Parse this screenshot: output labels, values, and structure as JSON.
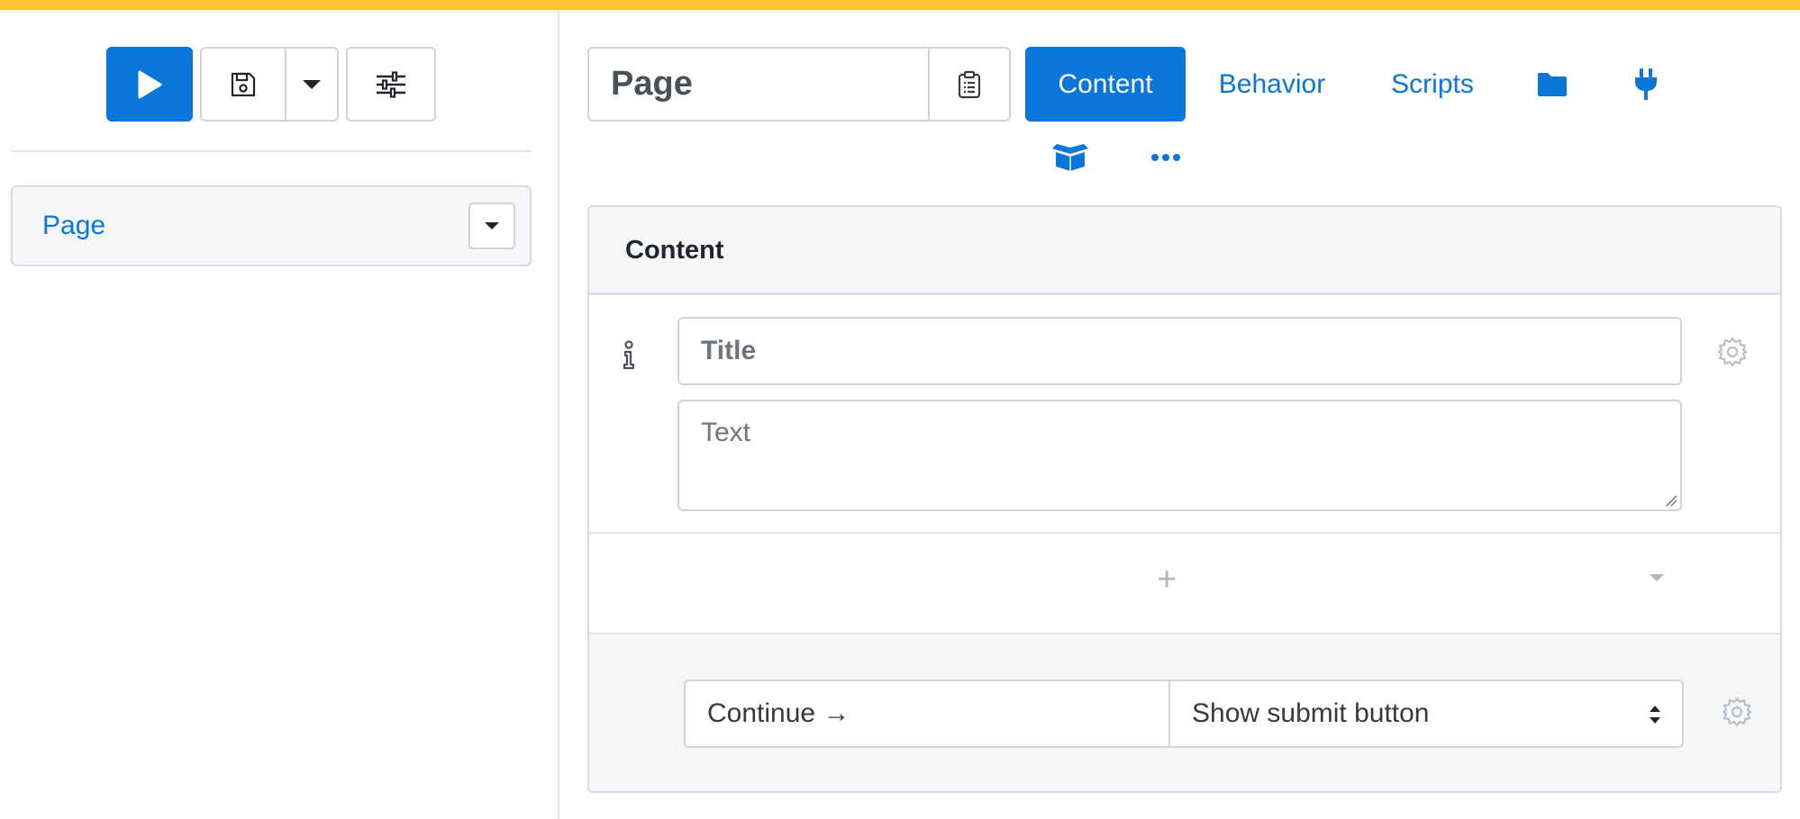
{
  "colors": {
    "accent": "#0b76da",
    "top_bar": "#fcc332",
    "muted": "#adb5bd"
  },
  "toolbar": {
    "run_icon": "play-icon",
    "save_icon": "save-icon",
    "save_menu_icon": "caret-down-icon",
    "settings_icon": "sliders-icon"
  },
  "sidebar": {
    "items": [
      {
        "label": "Page"
      }
    ]
  },
  "header": {
    "name_value": "Page",
    "tabs": [
      {
        "label": "Content",
        "active": true
      },
      {
        "label": "Behavior",
        "active": false
      },
      {
        "label": "Scripts",
        "active": false
      }
    ],
    "icon_tabs": [
      "folder-icon",
      "plug-icon",
      "box-open-icon",
      "ellipsis-icon"
    ]
  },
  "panel": {
    "title": "Content",
    "block": {
      "title_placeholder": "Title",
      "text_placeholder": "Text"
    },
    "add_label": "+",
    "footer": {
      "continue_label": "Continue →",
      "submit_option": "Show submit button"
    }
  }
}
